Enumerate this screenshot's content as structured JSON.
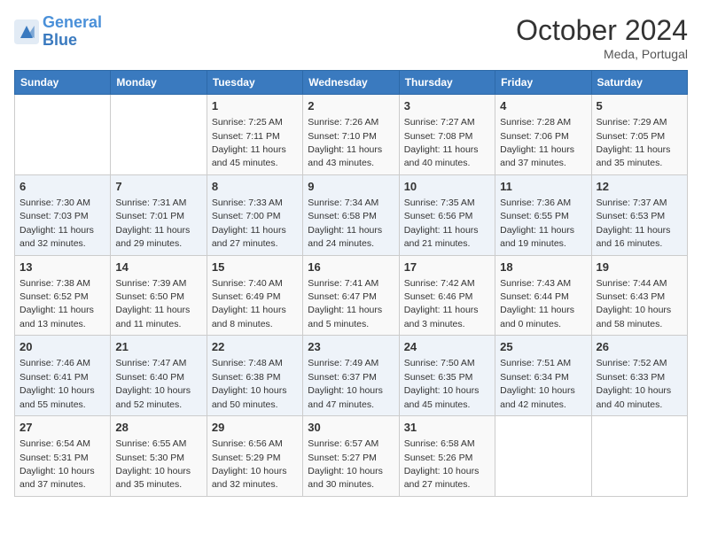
{
  "logo": {
    "line1": "General",
    "line2": "Blue"
  },
  "title": "October 2024",
  "subtitle": "Meda, Portugal",
  "days_header": [
    "Sunday",
    "Monday",
    "Tuesday",
    "Wednesday",
    "Thursday",
    "Friday",
    "Saturday"
  ],
  "weeks": [
    [
      {
        "day": "",
        "info": ""
      },
      {
        "day": "",
        "info": ""
      },
      {
        "day": "1",
        "info": "Sunrise: 7:25 AM\nSunset: 7:11 PM\nDaylight: 11 hours and 45 minutes."
      },
      {
        "day": "2",
        "info": "Sunrise: 7:26 AM\nSunset: 7:10 PM\nDaylight: 11 hours and 43 minutes."
      },
      {
        "day": "3",
        "info": "Sunrise: 7:27 AM\nSunset: 7:08 PM\nDaylight: 11 hours and 40 minutes."
      },
      {
        "day": "4",
        "info": "Sunrise: 7:28 AM\nSunset: 7:06 PM\nDaylight: 11 hours and 37 minutes."
      },
      {
        "day": "5",
        "info": "Sunrise: 7:29 AM\nSunset: 7:05 PM\nDaylight: 11 hours and 35 minutes."
      }
    ],
    [
      {
        "day": "6",
        "info": "Sunrise: 7:30 AM\nSunset: 7:03 PM\nDaylight: 11 hours and 32 minutes."
      },
      {
        "day": "7",
        "info": "Sunrise: 7:31 AM\nSunset: 7:01 PM\nDaylight: 11 hours and 29 minutes."
      },
      {
        "day": "8",
        "info": "Sunrise: 7:33 AM\nSunset: 7:00 PM\nDaylight: 11 hours and 27 minutes."
      },
      {
        "day": "9",
        "info": "Sunrise: 7:34 AM\nSunset: 6:58 PM\nDaylight: 11 hours and 24 minutes."
      },
      {
        "day": "10",
        "info": "Sunrise: 7:35 AM\nSunset: 6:56 PM\nDaylight: 11 hours and 21 minutes."
      },
      {
        "day": "11",
        "info": "Sunrise: 7:36 AM\nSunset: 6:55 PM\nDaylight: 11 hours and 19 minutes."
      },
      {
        "day": "12",
        "info": "Sunrise: 7:37 AM\nSunset: 6:53 PM\nDaylight: 11 hours and 16 minutes."
      }
    ],
    [
      {
        "day": "13",
        "info": "Sunrise: 7:38 AM\nSunset: 6:52 PM\nDaylight: 11 hours and 13 minutes."
      },
      {
        "day": "14",
        "info": "Sunrise: 7:39 AM\nSunset: 6:50 PM\nDaylight: 11 hours and 11 minutes."
      },
      {
        "day": "15",
        "info": "Sunrise: 7:40 AM\nSunset: 6:49 PM\nDaylight: 11 hours and 8 minutes."
      },
      {
        "day": "16",
        "info": "Sunrise: 7:41 AM\nSunset: 6:47 PM\nDaylight: 11 hours and 5 minutes."
      },
      {
        "day": "17",
        "info": "Sunrise: 7:42 AM\nSunset: 6:46 PM\nDaylight: 11 hours and 3 minutes."
      },
      {
        "day": "18",
        "info": "Sunrise: 7:43 AM\nSunset: 6:44 PM\nDaylight: 11 hours and 0 minutes."
      },
      {
        "day": "19",
        "info": "Sunrise: 7:44 AM\nSunset: 6:43 PM\nDaylight: 10 hours and 58 minutes."
      }
    ],
    [
      {
        "day": "20",
        "info": "Sunrise: 7:46 AM\nSunset: 6:41 PM\nDaylight: 10 hours and 55 minutes."
      },
      {
        "day": "21",
        "info": "Sunrise: 7:47 AM\nSunset: 6:40 PM\nDaylight: 10 hours and 52 minutes."
      },
      {
        "day": "22",
        "info": "Sunrise: 7:48 AM\nSunset: 6:38 PM\nDaylight: 10 hours and 50 minutes."
      },
      {
        "day": "23",
        "info": "Sunrise: 7:49 AM\nSunset: 6:37 PM\nDaylight: 10 hours and 47 minutes."
      },
      {
        "day": "24",
        "info": "Sunrise: 7:50 AM\nSunset: 6:35 PM\nDaylight: 10 hours and 45 minutes."
      },
      {
        "day": "25",
        "info": "Sunrise: 7:51 AM\nSunset: 6:34 PM\nDaylight: 10 hours and 42 minutes."
      },
      {
        "day": "26",
        "info": "Sunrise: 7:52 AM\nSunset: 6:33 PM\nDaylight: 10 hours and 40 minutes."
      }
    ],
    [
      {
        "day": "27",
        "info": "Sunrise: 6:54 AM\nSunset: 5:31 PM\nDaylight: 10 hours and 37 minutes."
      },
      {
        "day": "28",
        "info": "Sunrise: 6:55 AM\nSunset: 5:30 PM\nDaylight: 10 hours and 35 minutes."
      },
      {
        "day": "29",
        "info": "Sunrise: 6:56 AM\nSunset: 5:29 PM\nDaylight: 10 hours and 32 minutes."
      },
      {
        "day": "30",
        "info": "Sunrise: 6:57 AM\nSunset: 5:27 PM\nDaylight: 10 hours and 30 minutes."
      },
      {
        "day": "31",
        "info": "Sunrise: 6:58 AM\nSunset: 5:26 PM\nDaylight: 10 hours and 27 minutes."
      },
      {
        "day": "",
        "info": ""
      },
      {
        "day": "",
        "info": ""
      }
    ]
  ]
}
